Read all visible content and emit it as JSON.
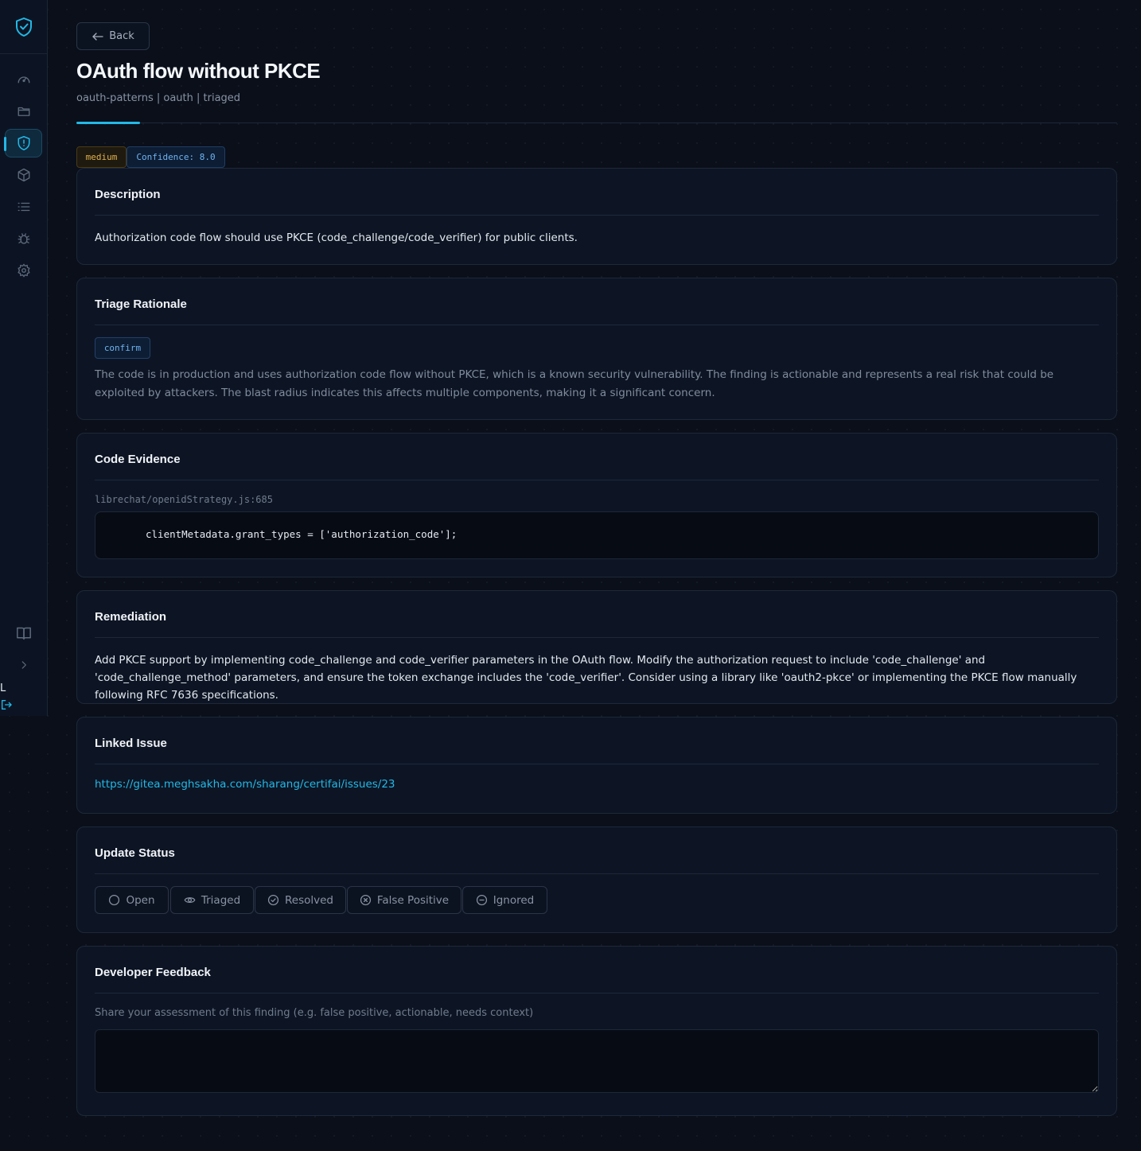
{
  "sidebar": {
    "items": [
      {
        "icon": "gauge-icon"
      },
      {
        "icon": "folder-icon"
      },
      {
        "icon": "shield-alert-icon",
        "active": true
      },
      {
        "icon": "package-icon"
      },
      {
        "icon": "list-icon"
      },
      {
        "icon": "bug-icon"
      },
      {
        "icon": "gear-icon"
      }
    ],
    "bottom": [
      {
        "icon": "book-icon"
      },
      {
        "icon": "chevron-right-icon"
      }
    ],
    "user_initial": "L",
    "accent": "#22b8e6"
  },
  "header": {
    "back_label": "Back",
    "title": "OAuth flow without PKCE",
    "subtitle": "oauth-patterns | oauth | triaged"
  },
  "badges": {
    "severity": "medium",
    "confidence": "Confidence: 8.0"
  },
  "description": {
    "title": "Description",
    "text": "Authorization code flow should use PKCE (code_challenge/code_verifier) for public clients."
  },
  "triage": {
    "title": "Triage Rationale",
    "verdict": "confirm",
    "text": "The code is in production and uses authorization code flow without PKCE, which is a known security vulnerability. The finding is actionable and represents a real risk that could be exploited by attackers. The blast radius indicates this affects multiple components, making it a significant concern."
  },
  "evidence": {
    "title": "Code Evidence",
    "file": "librechat/openidStrategy.js:685",
    "code": "clientMetadata.grant_types = ['authorization_code'];"
  },
  "remediation": {
    "title": "Remediation",
    "text": "Add PKCE support by implementing code_challenge and code_verifier parameters in the OAuth flow. Modify the authorization request to include 'code_challenge' and 'code_challenge_method' parameters, and ensure the token exchange includes the 'code_verifier'. Consider using a library like 'oauth2-pkce' or implementing the PKCE flow manually following RFC 7636 specifications."
  },
  "linked_issue": {
    "title": "Linked Issue",
    "url": "https://gitea.meghsakha.com/sharang/certifai/issues/23"
  },
  "status": {
    "title": "Update Status",
    "options": [
      {
        "label": "Open",
        "icon": "circle-icon"
      },
      {
        "label": "Triaged",
        "icon": "eye-icon"
      },
      {
        "label": "Resolved",
        "icon": "check-circle-icon"
      },
      {
        "label": "False Positive",
        "icon": "x-circle-icon"
      },
      {
        "label": "Ignored",
        "icon": "minus-circle-icon"
      }
    ]
  },
  "feedback": {
    "title": "Developer Feedback",
    "hint": "Share your assessment of this finding (e.g. false positive, actionable, needs context)",
    "value": ""
  }
}
